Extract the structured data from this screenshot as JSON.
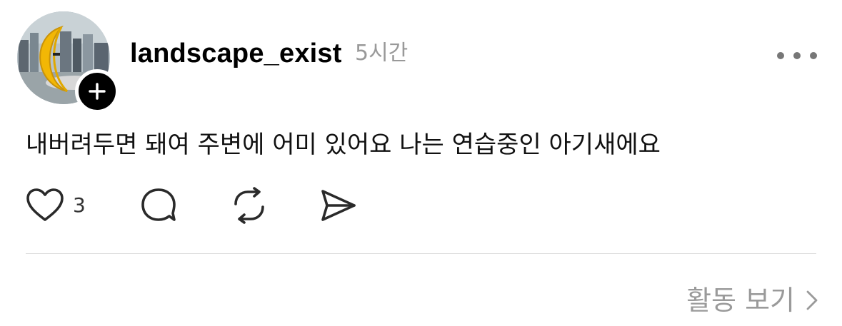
{
  "post": {
    "author": {
      "username": "landscape_exist",
      "avatar_icon": "avatar-photo-crescent-moon"
    },
    "timestamp": "5시간",
    "text": "내버려두면 돼여 주변에 어미 있어요 나는 연습중인 아기새에요",
    "actions": {
      "like_count": "3",
      "icons": [
        "heart-icon",
        "comment-icon",
        "repost-icon",
        "share-icon"
      ]
    },
    "footer": {
      "activity_label": "활동 보기"
    }
  },
  "colors": {
    "text_primary": "#000000",
    "text_secondary": "#999999",
    "divider": "#dcdcdc",
    "avatar_moon": "#f2b705"
  }
}
